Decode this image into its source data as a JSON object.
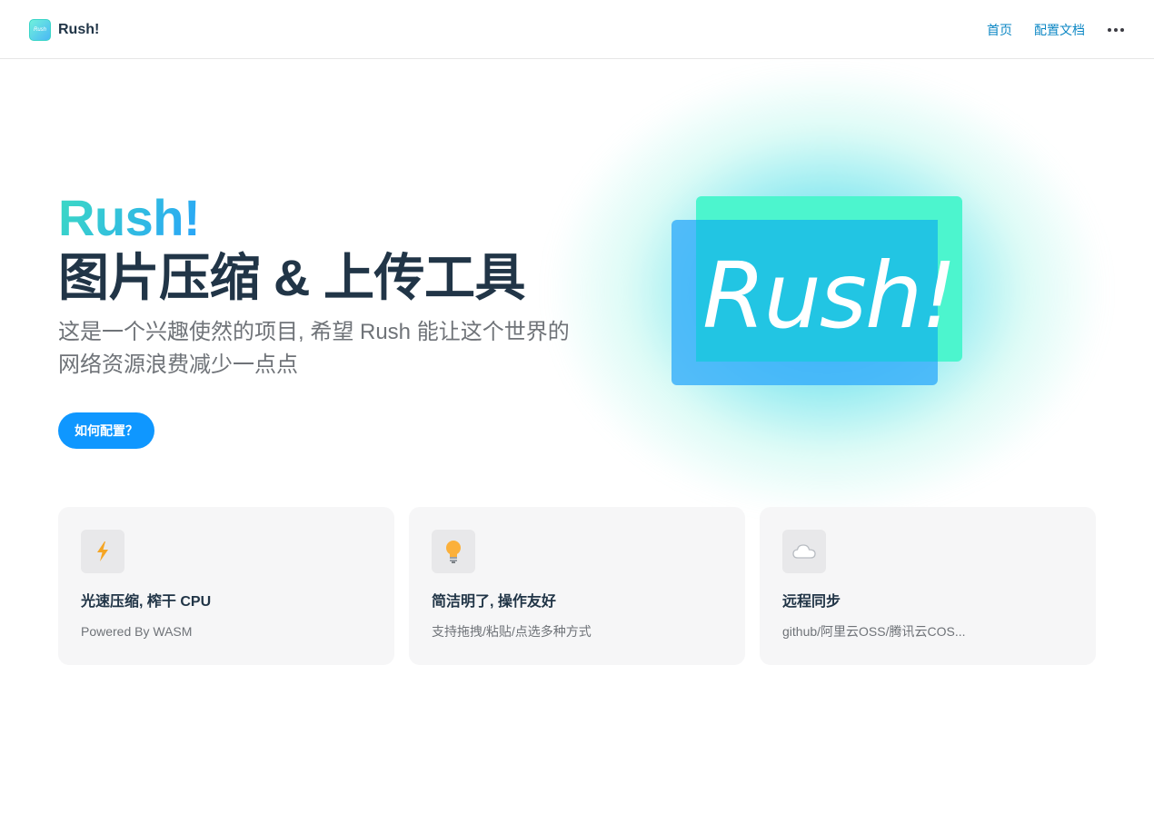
{
  "nav": {
    "brand_name": "Rush!",
    "links": [
      {
        "label": "首页"
      },
      {
        "label": "配置文档"
      }
    ]
  },
  "hero": {
    "name": "Rush!",
    "text": "图片压缩 & 上传工具",
    "tagline": "这是一个兴趣使然的项目, 希望 Rush 能让这个世界的网络资源浪费减少一点点",
    "action_label": "如何配置？",
    "image_text": "Rush!"
  },
  "features": [
    {
      "icon": "lightning-icon",
      "title": "光速压缩, 榨干 CPU",
      "details": "Powered By WASM"
    },
    {
      "icon": "lightbulb-icon",
      "title": "简洁明了, 操作友好",
      "details": "支持拖拽/粘贴/点选多种方式"
    },
    {
      "icon": "cloud-icon",
      "title": "远程同步",
      "details": "github/阿里云OSS/腾讯云COS..."
    }
  ],
  "colors": {
    "accent": "#0f97ff",
    "brand_gradient_start": "#3ad5c8",
    "brand_gradient_end": "#2aa8f5",
    "text": "#213547",
    "link": "#0c87c4"
  }
}
